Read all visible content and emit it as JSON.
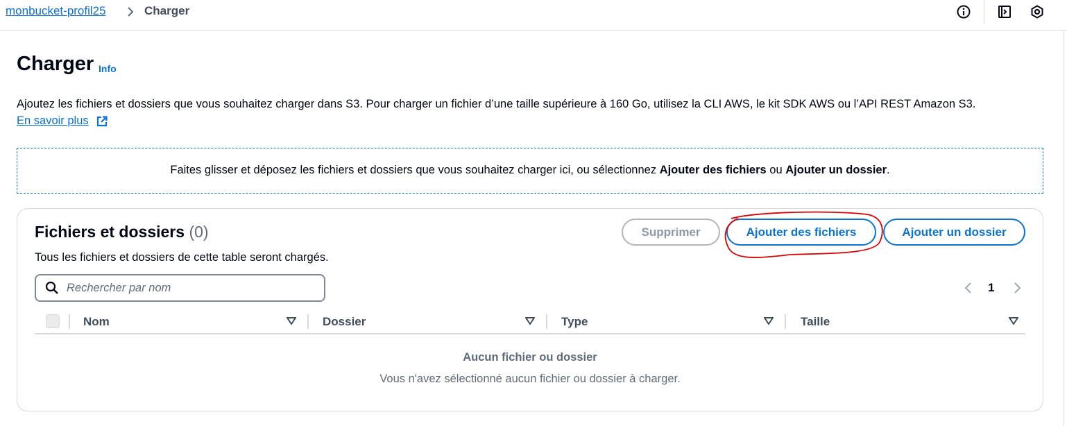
{
  "breadcrumb": {
    "bucket": "monbucket-profil25",
    "current": "Charger"
  },
  "header": {
    "title": "Charger",
    "info": "Info",
    "description": "Ajoutez les fichiers et dossiers que vous souhaitez charger dans S3. Pour charger un fichier d’une taille supérieure à 160 Go, utilisez la CLI AWS, le kit SDK AWS ou l’API REST Amazon S3.",
    "learn_more": "En savoir plus"
  },
  "dropzone": {
    "text_before": "Faites glisser et déposez les fichiers et dossiers que vous souhaitez charger ici, ou sélectionnez ",
    "bold1": "Ajouter des fichiers",
    "middle": " ou ",
    "bold2": "Ajouter un dossier",
    "end": "."
  },
  "panel": {
    "title": "Fichiers et dossiers",
    "count": "(0)",
    "description": "Tous les fichiers et dossiers de cette table seront chargés.",
    "buttons": {
      "delete": "Supprimer",
      "add_files": "Ajouter des fichiers",
      "add_folder": "Ajouter un dossier"
    },
    "search_placeholder": "Rechercher par nom",
    "page": "1",
    "columns": [
      "Nom",
      "Dossier",
      "Type",
      "Taille"
    ],
    "empty_title": "Aucun fichier ou dossier",
    "empty_desc": "Vous n'avez sélectionné aucun fichier ou dossier à charger."
  },
  "colors": {
    "link": "#0972d3",
    "annotation": "#e00000",
    "disabled": "#8d99a8"
  },
  "icons": [
    "chevron-right-icon",
    "info-circle-icon",
    "side-panel-icon",
    "settings-hex-icon",
    "external-link-icon",
    "search-icon",
    "chevron-left-icon",
    "sort-down-icon"
  ]
}
